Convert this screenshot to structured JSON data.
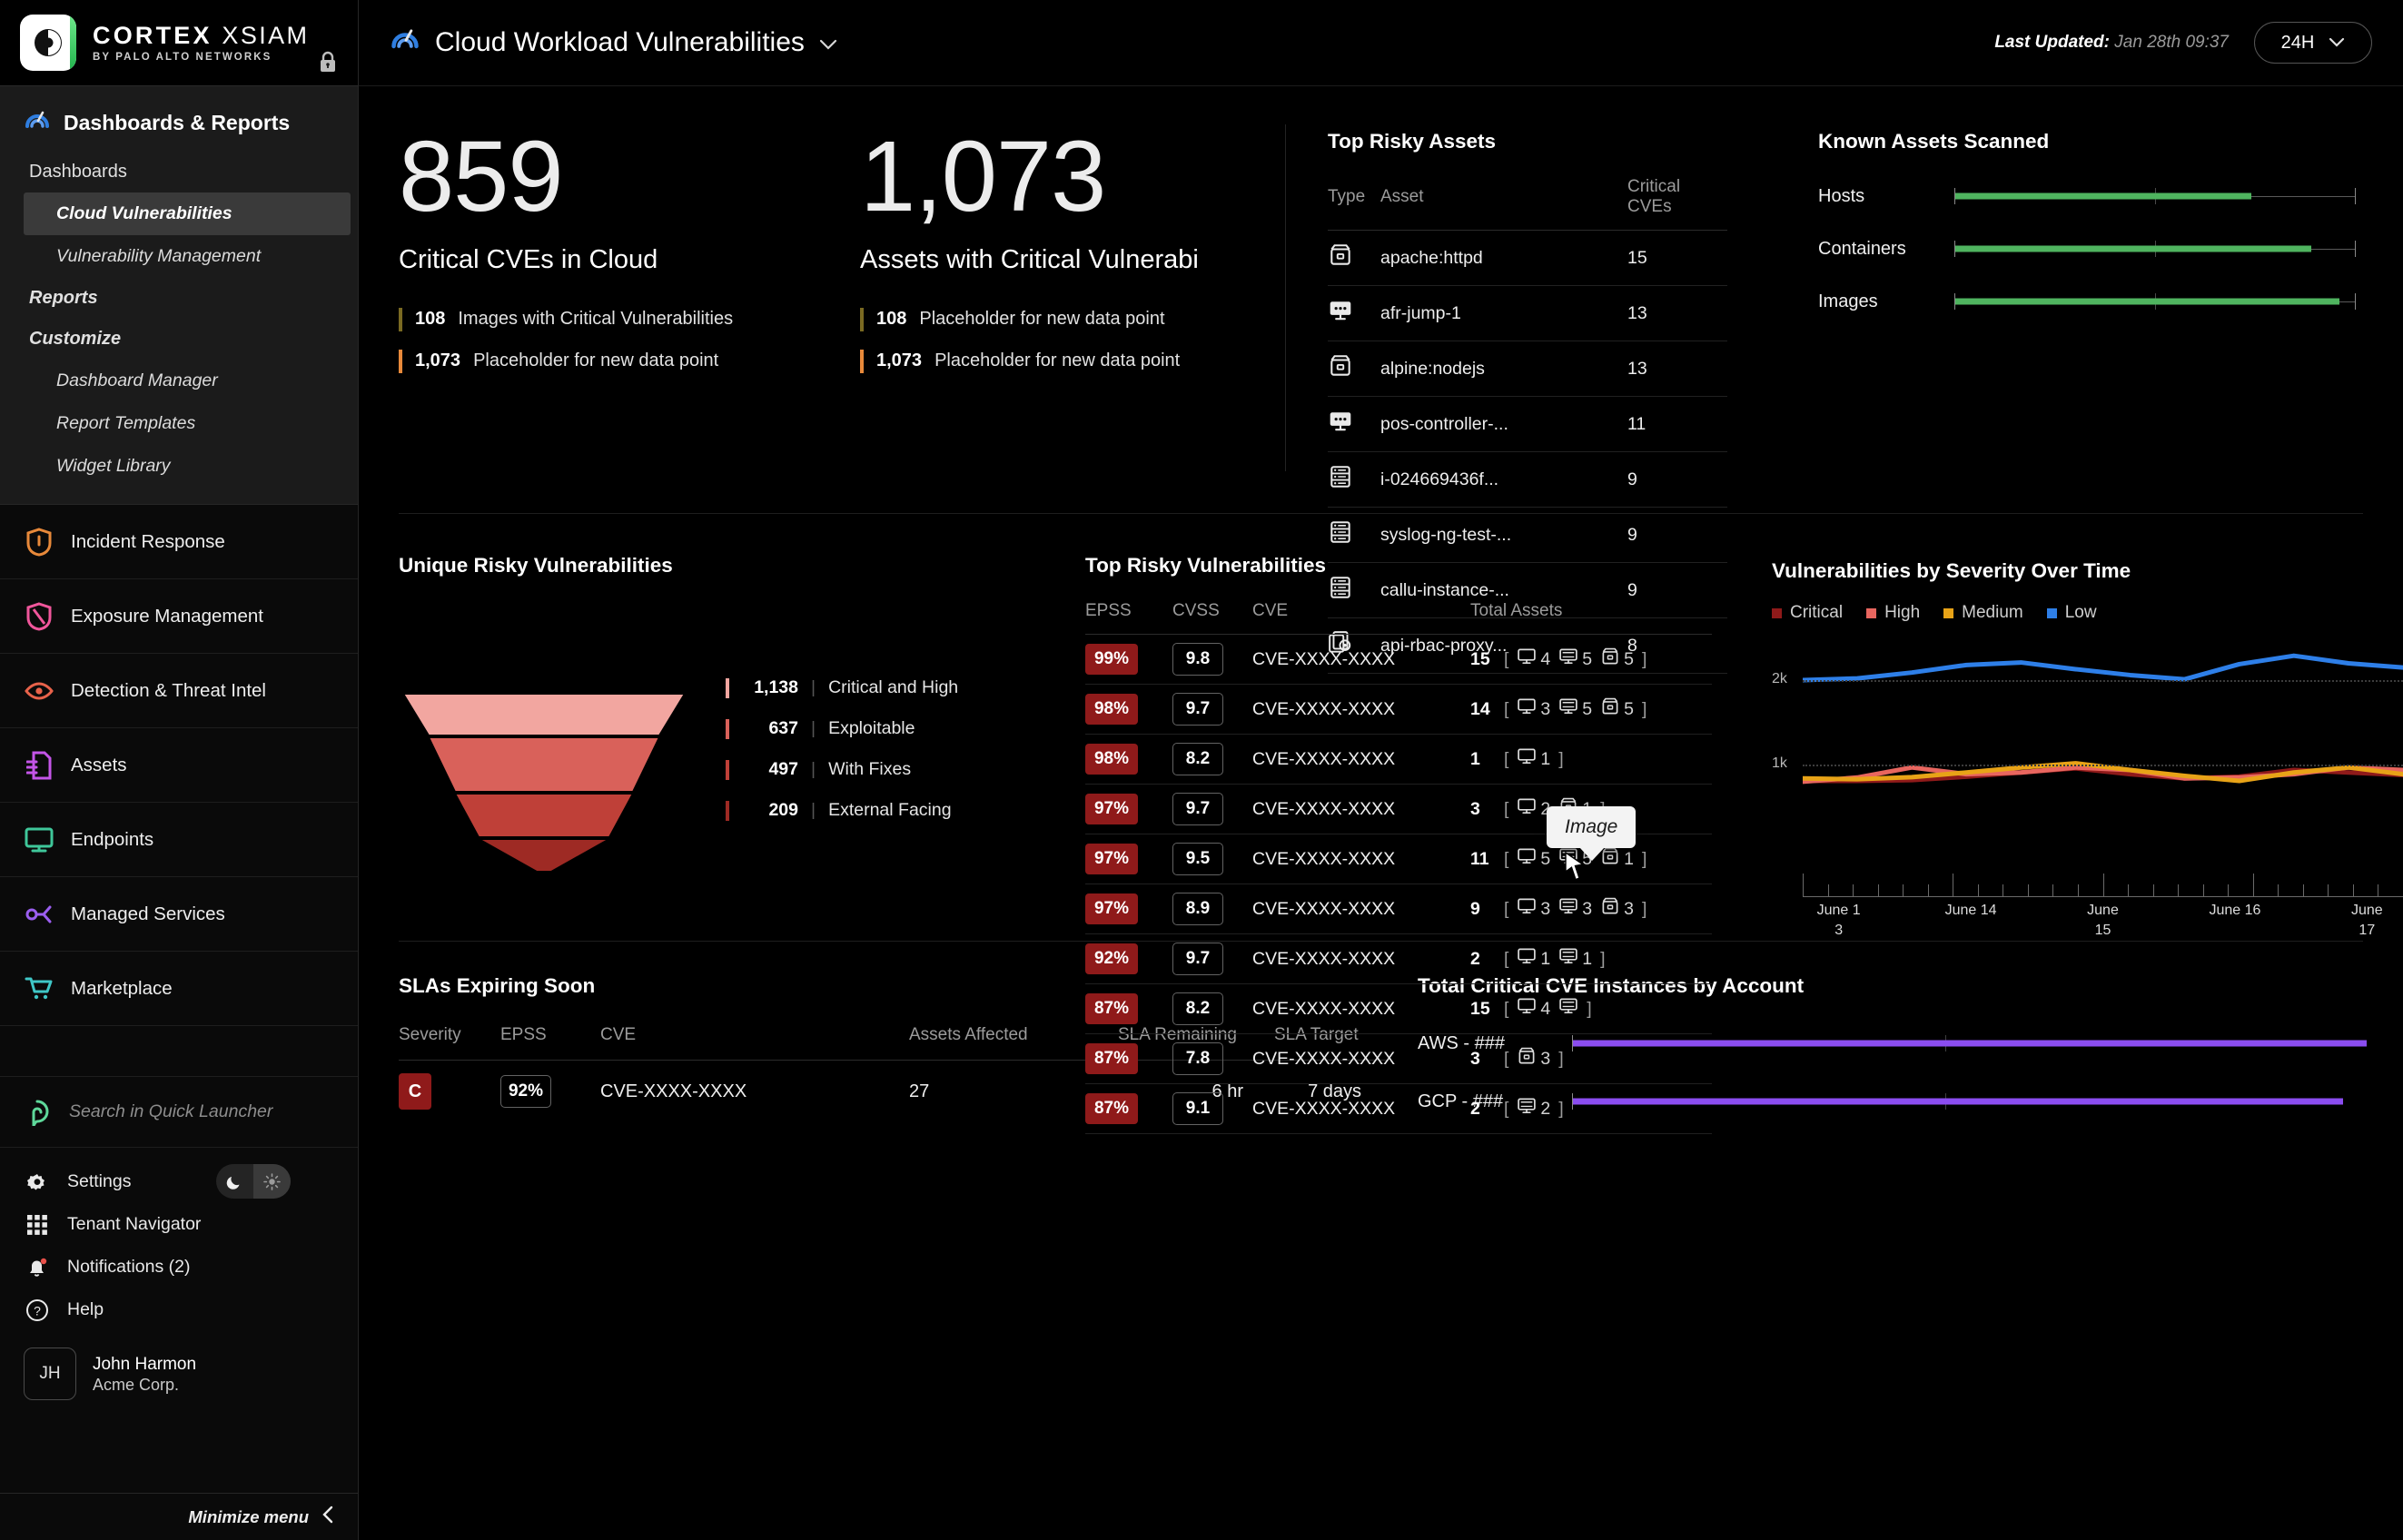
{
  "brand": {
    "name_bold": "CORTEX",
    "name_thin": "XSIAM",
    "tagline": "BY PALO ALTO NETWORKS",
    "lock_icon": "lock-icon"
  },
  "sidebar": {
    "section_title": "Dashboards & Reports",
    "section_icon": "gauge-icon",
    "groups": [
      {
        "label": "Dashboards",
        "level": 1,
        "italic": false
      },
      {
        "label": "Cloud Vulnerabilities",
        "level": 2,
        "active": true
      },
      {
        "label": "Vulnerability Management",
        "level": 2,
        "active": false
      },
      {
        "label": "Reports",
        "level": 1,
        "italic": true
      },
      {
        "label": "Customize",
        "level": 1,
        "italic": true
      },
      {
        "label": "Dashboard Manager",
        "level": 2,
        "active": false
      },
      {
        "label": "Report Templates",
        "level": 2,
        "active": false
      },
      {
        "label": "Widget Library",
        "level": 2,
        "active": false
      }
    ],
    "nav": [
      {
        "label": "Incident Response",
        "icon": "shield-icon",
        "color": "#e8893a"
      },
      {
        "label": "Exposure Management",
        "icon": "shield-slash-icon",
        "color": "#f0569b"
      },
      {
        "label": "Detection & Threat Intel",
        "icon": "eye-icon",
        "color": "#e8624a"
      },
      {
        "label": "Assets",
        "icon": "document-icon",
        "color": "#c455e8"
      },
      {
        "label": "Endpoints",
        "icon": "monitor-icon",
        "color": "#3fc79a"
      },
      {
        "label": "Managed Services",
        "icon": "nodes-icon",
        "color": "#9b5ef0"
      },
      {
        "label": "Marketplace",
        "icon": "cart-icon",
        "color": "#3fc7c7"
      }
    ],
    "quick_launcher": {
      "placeholder": "Search in Quick Launcher",
      "icon": "quick-launcher-icon"
    },
    "utilities": [
      {
        "label": "Settings",
        "icon": "gear-icon"
      },
      {
        "label": "Tenant Navigator",
        "icon": "grid-icon"
      },
      {
        "label": "Notifications (2)",
        "icon": "bell-icon"
      },
      {
        "label": "Help",
        "icon": "question-circle-icon"
      }
    ],
    "theme": {
      "dark_icon": "moon-icon",
      "light_icon": "sun-icon",
      "active": "light"
    },
    "user": {
      "initials": "JH",
      "name": "John Harmon",
      "org": "Acme Corp."
    },
    "minimize": {
      "label": "Minimize menu",
      "icon": "chevron-left-icon"
    }
  },
  "header": {
    "dashboard_icon": "gauge-icon",
    "title": "Cloud Workload Vulnerabilities",
    "dropdown_icon": "chevron-down-icon",
    "last_updated_label": "Last Updated:",
    "last_updated_value": "Jan 28th 09:37",
    "range": "24H",
    "range_icon": "chevron-down-icon"
  },
  "kpis": [
    {
      "value": "859",
      "label": "Critical CVEs in Cloud",
      "subs": [
        {
          "value": "108",
          "text": "Images with Critical Vulnerabilities",
          "color": "#7a6a22"
        },
        {
          "value": "1,073",
          "text": "Placeholder for new data point",
          "color": "#e8893a"
        }
      ]
    },
    {
      "value": "1,073",
      "label": "Assets with Critical Vulnerabi",
      "subs": [
        {
          "value": "108",
          "text": "Placeholder for new data point",
          "color": "#7a6a22"
        },
        {
          "value": "1,073",
          "text": "Placeholder for new data point",
          "color": "#e8893a"
        }
      ]
    }
  ],
  "top_risky_assets": {
    "title": "Top Risky Assets",
    "columns": [
      "Type",
      "Asset",
      "Critical CVEs"
    ],
    "rows": [
      {
        "icon": "container-icon",
        "asset": "apache:httpd",
        "cves": "15"
      },
      {
        "icon": "host-icon",
        "asset": "afr-jump-1",
        "cves": "13"
      },
      {
        "icon": "container-icon",
        "asset": "alpine:nodejs",
        "cves": "13"
      },
      {
        "icon": "host-icon",
        "asset": "pos-controller-...",
        "cves": "11"
      },
      {
        "icon": "server-icon",
        "asset": "i-024669436f...",
        "cves": "9"
      },
      {
        "icon": "server-icon",
        "asset": "syslog-ng-test-...",
        "cves": "9"
      },
      {
        "icon": "server-icon",
        "asset": "callu-instance-...",
        "cves": "9"
      },
      {
        "icon": "service-icon",
        "asset": "api-rbac-proxy...",
        "cves": "8"
      }
    ]
  },
  "known_assets": {
    "title": "Known Assets Scanned",
    "chart_data": {
      "type": "bar",
      "title": "Known Assets Scanned",
      "categories": [
        "Hosts",
        "Containers",
        "Images"
      ],
      "values": [
        74,
        89,
        96
      ],
      "xlabel": "",
      "ylabel": "",
      "ylim": [
        0,
        100
      ],
      "grid": true,
      "bar_color": "#4fb45f"
    }
  },
  "unique_risky": {
    "title": "Unique Risky Vulnerabilities",
    "chart_data": {
      "type": "bar",
      "title": "Unique Risky Vulnerabilities",
      "categories": [
        "Critical and High",
        "Exploitable",
        "With Fixes",
        "External Facing"
      ],
      "values": [
        1138,
        637,
        497,
        209
      ],
      "labels": [
        "1,138",
        "637",
        "497",
        "209"
      ],
      "colors": [
        "#f2a6a0",
        "#d9615a",
        "#bf4038",
        "#9e2a24"
      ],
      "xlabel": "",
      "ylabel": "",
      "grid": false
    }
  },
  "top_risky_vulns": {
    "title": "Top Risky Vulnerabilities",
    "columns": [
      "EPSS",
      "CVSS",
      "CVE",
      "Total Assets"
    ],
    "rows": [
      {
        "epss": "99%",
        "cvss": "9.8",
        "cve": "CVE-XXXX-XXXX",
        "total": "15",
        "breakdown": [
          {
            "icon": "host-icon",
            "n": "4"
          },
          {
            "icon": "server-icon",
            "n": "5"
          },
          {
            "icon": "container-icon",
            "n": "5"
          }
        ]
      },
      {
        "epss": "98%",
        "cvss": "9.7",
        "cve": "CVE-XXXX-XXXX",
        "total": "14",
        "breakdown": [
          {
            "icon": "host-icon",
            "n": "3"
          },
          {
            "icon": "server-icon",
            "n": "5"
          },
          {
            "icon": "container-icon",
            "n": "5"
          }
        ]
      },
      {
        "epss": "98%",
        "cvss": "8.2",
        "cve": "CVE-XXXX-XXXX",
        "total": "1",
        "breakdown": [
          {
            "icon": "host-icon",
            "n": "1"
          }
        ]
      },
      {
        "epss": "97%",
        "cvss": "9.7",
        "cve": "CVE-XXXX-XXXX",
        "total": "3",
        "breakdown": [
          {
            "icon": "host-icon",
            "n": "2"
          },
          {
            "icon": "container-icon",
            "n": "1"
          }
        ]
      },
      {
        "epss": "97%",
        "cvss": "9.5",
        "cve": "CVE-XXXX-XXXX",
        "total": "11",
        "breakdown": [
          {
            "icon": "host-icon",
            "n": "5"
          },
          {
            "icon": "server-icon",
            "n": "5"
          },
          {
            "icon": "container-icon",
            "n": "1"
          }
        ]
      },
      {
        "epss": "97%",
        "cvss": "8.9",
        "cve": "CVE-XXXX-XXXX",
        "total": "9",
        "breakdown": [
          {
            "icon": "host-icon",
            "n": "3"
          },
          {
            "icon": "server-icon",
            "n": "3"
          },
          {
            "icon": "container-icon",
            "n": "3"
          }
        ]
      },
      {
        "epss": "92%",
        "cvss": "9.7",
        "cve": "CVE-XXXX-XXXX",
        "total": "2",
        "breakdown": [
          {
            "icon": "host-icon",
            "n": "1"
          },
          {
            "icon": "server-icon",
            "n": "1"
          }
        ]
      },
      {
        "epss": "87%",
        "cvss": "8.2",
        "cve": "CVE-XXXX-XXXX",
        "total": "15",
        "breakdown": [
          {
            "icon": "host-icon",
            "n": "4"
          },
          {
            "icon": "server-icon",
            "n": ""
          }
        ]
      },
      {
        "epss": "87%",
        "cvss": "7.8",
        "cve": "CVE-XXXX-XXXX",
        "total": "3",
        "breakdown": [
          {
            "icon": "container-icon",
            "n": "3"
          }
        ]
      },
      {
        "epss": "87%",
        "cvss": "9.1",
        "cve": "CVE-XXXX-XXXX",
        "total": "2",
        "breakdown": [
          {
            "icon": "server-icon",
            "n": "2"
          }
        ]
      }
    ],
    "tooltip": "Image"
  },
  "severity_over_time": {
    "title": "Vulnerabilities by Severity Over Time",
    "chart_data": {
      "type": "line",
      "title": "Vulnerabilities by Severity Over Time",
      "legend": [
        "Critical",
        "High",
        "Medium",
        "Low"
      ],
      "legend_position": "top-left",
      "colors": {
        "Critical": "#8f1a1a",
        "High": "#e8665f",
        "Medium": "#e8a317",
        "Low": "#2e7fe8"
      },
      "x": [
        "June 1\n3",
        "June 14",
        "June\n15",
        "June 16",
        "June\n17"
      ],
      "xtick_labels": [
        "June 1 3",
        "June 14",
        "June 15",
        "June 16",
        "June 17"
      ],
      "ylabel": "",
      "xlabel": "",
      "ytick_labels": [
        "2k",
        "1k"
      ],
      "ylim": [
        0,
        2400
      ],
      "grid": true,
      "series": [
        {
          "name": "Low",
          "values": [
            2000,
            2020,
            2090,
            2180,
            2210,
            2130,
            2060,
            2010,
            2190,
            2290,
            2200,
            2150
          ]
        },
        {
          "name": "Medium",
          "values": [
            830,
            820,
            845,
            900,
            960,
            1010,
            930,
            860,
            800,
            900,
            960,
            880
          ]
        },
        {
          "name": "High",
          "values": [
            790,
            840,
            960,
            880,
            900,
            960,
            930,
            830,
            840,
            880,
            960,
            930
          ]
        },
        {
          "name": "Critical",
          "values": [
            800,
            800,
            810,
            850,
            900,
            950,
            880,
            830,
            850,
            930,
            900,
            870
          ]
        }
      ]
    }
  },
  "slas": {
    "title": "SLAs Expiring Soon",
    "columns": [
      "Severity",
      "EPSS",
      "CVE",
      "Assets Affected",
      "SLA Remaining",
      "SLA Target"
    ],
    "rows": [
      {
        "severity": "C",
        "epss": "92%",
        "cve": "CVE-XXXX-XXXX",
        "assets": "27",
        "remaining": "6 hr",
        "target": "7 days"
      }
    ]
  },
  "accounts": {
    "title": "Total Critical CVE Instances by Account",
    "chart_data": {
      "type": "bar",
      "title": "Total Critical CVE Instances by Account",
      "categories": [
        "AWS - ###",
        "GCP - ###"
      ],
      "values": [
        100,
        97
      ],
      "bar_color": "#8b4df0",
      "xlabel": "",
      "ylabel": "",
      "grid": true
    }
  }
}
